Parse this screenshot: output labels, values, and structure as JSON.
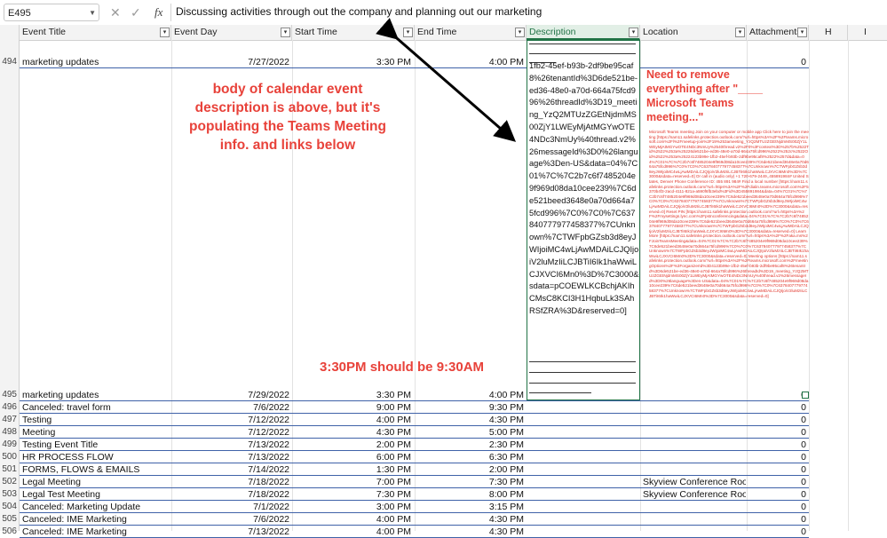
{
  "formula_bar": {
    "name_box": "E495",
    "cancel_icon": "close-icon",
    "enter_icon": "check-icon",
    "fx": "fx",
    "formula": "Discussing activities through out the company and planning out our marketing"
  },
  "columns": [
    {
      "id": "A",
      "label": "Event Title"
    },
    {
      "id": "B",
      "label": "Event Day"
    },
    {
      "id": "C",
      "label": "Start Time"
    },
    {
      "id": "D",
      "label": "End Time"
    },
    {
      "id": "E",
      "label": "Description"
    },
    {
      "id": "F",
      "label": "Location"
    },
    {
      "id": "G",
      "label": "Attachments"
    },
    {
      "id": "H",
      "label": "H"
    },
    {
      "id": "I",
      "label": "I"
    }
  ],
  "rows": [
    {
      "num": "494",
      "title": "marketing updates",
      "day": "7/27/2022",
      "start": "3:30 PM",
      "end": "4:00 PM",
      "location": "",
      "attachments": "0"
    },
    {
      "num": "495",
      "title": "marketing updates",
      "day": "7/29/2022",
      "start": "3:30 PM",
      "end": "4:00 PM",
      "location": "",
      "attachments": "0"
    },
    {
      "num": "496",
      "title": "Canceled: travel form",
      "day": "7/6/2022",
      "start": "9:00 PM",
      "end": "9:30 PM",
      "location": "",
      "attachments": "0"
    },
    {
      "num": "497",
      "title": "Testing",
      "day": "7/12/2022",
      "start": "4:00 PM",
      "end": "4:30 PM",
      "location": "",
      "attachments": "0"
    },
    {
      "num": "498",
      "title": "Meeting",
      "day": "7/12/2022",
      "start": "4:30 PM",
      "end": "5:00 PM",
      "location": "",
      "attachments": "0"
    },
    {
      "num": "499",
      "title": "Testing Event Title",
      "day": "7/13/2022",
      "start": "2:00 PM",
      "end": "2:30 PM",
      "location": "",
      "attachments": "0"
    },
    {
      "num": "500",
      "title": "HR PROCESS FLOW",
      "day": "7/13/2022",
      "start": "6:00 PM",
      "end": "6:30 PM",
      "location": "",
      "attachments": "0"
    },
    {
      "num": "501",
      "title": "FORMS, FLOWS & EMAILS",
      "day": "7/14/2022",
      "start": "1:30 PM",
      "end": "2:00 PM",
      "location": "",
      "attachments": "0"
    },
    {
      "num": "502",
      "title": "Legal Meeting",
      "day": "7/18/2022",
      "start": "7:00 PM",
      "end": "7:30 PM",
      "location": "Skyview Conference Room",
      "attachments": "0"
    },
    {
      "num": "503",
      "title": "Legal Test Meeting",
      "day": "7/18/2022",
      "start": "7:30 PM",
      "end": "8:00 PM",
      "location": "Skyview Conference Room",
      "attachments": "0"
    },
    {
      "num": "504",
      "title": "Canceled: Marketing Update",
      "day": "7/1/2022",
      "start": "3:00 PM",
      "end": "3:15 PM",
      "location": "",
      "attachments": "0"
    },
    {
      "num": "505",
      "title": "Canceled: IME Marketing",
      "day": "7/6/2022",
      "start": "4:00 PM",
      "end": "4:30 PM",
      "location": "",
      "attachments": "0"
    },
    {
      "num": "506",
      "title": "Canceled: IME Marketing",
      "day": "7/13/2022",
      "start": "4:00 PM",
      "end": "4:30 PM",
      "location": "",
      "attachments": "0"
    }
  ],
  "description_text": "1fb2-45ef-b93b-2df9be95caf8%26tenantId%3D6de521be-ed36-48e0-a70d-664a75fcd996%26threadId%3D19_meeting_YzQ2MTUzZGEtNjdmMS00ZjY1LWEyMjAtMGYwOTE4NDc3NmUy%40thread.v2%26messageId%3D0%26language%3Den-US&data=04%7C01%7C%7C2b7c6f7485204e9f969d08da10cee239%7C6de521beed3648e0a70d664a75fcd996%7C0%7C0%7C637840777977458377%7CUnknown%7CTWFpbGZsb3d8eyJWIjoiMC4wLjAwMDAiLCJQIjoiV2luMzIiLCJBTiI6Ik1haWwiLCJXVCI6Mn0%3D%7C3000&sdata=pCOEWLKCBchjAKIhCMsC8KCI3H1HqbuLk3SAhRSfZRA%3D&reserved=0]",
  "location_blurb": "Microsoft Teams meeting Join on your computer or mobile app Click here to join the meeting [https://nam11.safelinks.protection.outlook.com/?url=https%3A%2F%2Fteams.microsoft.com%2Fl%2Fmeetup-join%2F19%253ameeting_YzQ2MTUzZGEtNjdmMS00ZjY1LWEyMjAtMGYwOTE4NDc3NmUy%2540thread.v2%2F0%3Fcontext%3D%257b%2522Tid%2522%253a%25226de521be-ed36-48e0-a70d-664a75fcd996%2522%252c%2522Oid%2522%253a%25224123b99e-1fb2-45ef-b93b-2df9be95caf8%2522%257d&data=04%7C01%7C%7C2b7c6f7485204e9f969d08da10cee239%7C6de521beed3648e0a70d664a75fcd996%7C0%7C0%7C637840777977458377%7CUnknown%7CTWFpbGZsb3d8eyJWIjoiMC4wLjAwMDAiLCJQIjoiV2luMzIiLCJBTiI6Ik1haWwiLCJXVCI6Mn0%3D%7C3000&sdata=reserved=0] Or call in (audio only) +1 720-679-2449,,455891984# United States, Denver Phone Conference ID: 455 891 984# Find a local number [https://nam11.safelinks.protection.outlook.com/?url=https%3A%2F%2Fdialin.teams.microsoft.com%2F5370b4f3-2acd-4111-821a-a590f6fb3ebd%3Fid%3D455891984&data=04%7C01%7C%7C2b7c6f7485204e9f969d08da10cee239%7C6de521beed3648e0a70d664a75fcd996%7C0%7C0%7C637840777977458377%7CUnknown%7CTWFpbGZsb3d8eyJWIjoiMC4wLjAwMDAiLCJQIjoiV2luMzIiLCJBTiI6Ik1haWwiLCJXVCI6Mn0%3D%7C3000&sdata=reserved=0] Reset PIN [https://nam11.safelinks.protection.outlook.com/?url=https%3A%2F%2Fmysettings.lync.com%2Fpstnconferencing&data=04%7C01%7C%7C2b7c6f7485204e9f969d08da10cee239%7C6de521beed3648e0a70d664a75fcd996%7C0%7C0%7C637840777977458377%7CUnknown%7CTWFpbGZsb3d8eyJWIjoiMC4wLjAwMDAiLCJQIjoiV2luMzIiLCJBTiI6Ik1haWwiLCJXVCI6Mn0%3D%7C3000&sdata=reserved=0] Learn More [https://nam11.safelinks.protection.outlook.com/?url=https%3A%2F%2Faka.ms%2FJoinTeamsMeeting&data=04%7C01%7C%7C2b7c6f7485204e9f969d08da10cee239%7C6de521beed3648e0a70d664a75fcd996%7C0%7C0%7C637840777977458377%7CUnknown%7CTWFpbGZsb3d8eyJWIjoiMC4wLjAwMDAiLCJQIjoiV2luMzIiLCJBTiI6Ik1haWwiLCJXVCI6Mn0%3D%7C3000&sdata=reserved=0] Meeting options [https://nam11.safelinks.protection.outlook.com/?url=https%3A%2F%2Fteams.microsoft.com%2FmeetingOptions%2F%3ForganizerId%3D4123b99e-1fb2-45ef-b93b-2df9be95caf8%26tenantId%3D6de521be-ed36-48e0-a70d-664a75fcd996%26threadId%3D19_meeting_YzQ2MTUzZGEtNjdmMS00ZjY1LWEyMjAtMGYwOTE4NDc3NmUy%40thread.v2%26messageId%3D0%26language%3Den-US&data=04%7C01%7C%7C2b7c6f7485204e9f969d08da10cee239%7C6de521beed3648e0a70d664a75fcd996%7C0%7C0%7C637840777977458377%7CUnknown%7CTWFpbGZsb3d8eyJWIjoiMC4wLjAwMDAiLCJQIjoiV2luMzIiLCJBTiI6Ik1haWwiLCJXVCI6Mn0%3D%7C3000&sdata=reserved=0]",
  "annotations": {
    "body_note": "body of calendar event description is above, but it's populating the Teams Meeting info. and links below",
    "remove_note": "Need to remove everything after \"____ Microsoft Teams meeting...\"",
    "time_note": "3:30PM should be 9:30AM"
  },
  "colors": {
    "annotation": "#e8423a",
    "active_column": "#217346",
    "selection_border": "#3f62a8"
  }
}
